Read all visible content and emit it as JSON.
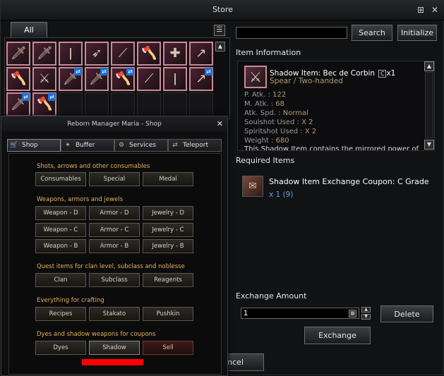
{
  "window": {
    "title": "Store"
  },
  "left": {
    "tab_all": "All",
    "grid": {
      "rows": [
        [
          "sword",
          "sword",
          "staff",
          "bow",
          "blade",
          "axe",
          "crossbow",
          "spear"
        ],
        [
          "axe",
          "swords",
          "sword",
          "sword",
          "axe",
          "blade",
          "staff",
          "spear"
        ],
        [
          "sword",
          "axe"
        ]
      ],
      "swap_marks": [
        [
          1,
          2
        ],
        [
          1,
          3
        ],
        [
          1,
          4
        ],
        [
          1,
          7
        ],
        [
          2,
          0
        ],
        [
          2,
          1
        ]
      ]
    }
  },
  "search": {
    "value": "",
    "search_label": "Search",
    "initialize_label": "Initialize"
  },
  "item_info": {
    "label": "Item Information",
    "name": "Shadow Item: Bec de Corbin",
    "grade": "C",
    "count": "x1",
    "type": "Spear / Two-handed",
    "stats": [
      {
        "label": "P. Atk. : ",
        "value": "122"
      },
      {
        "label": "M. Atk. : ",
        "value": "68"
      },
      {
        "label": "Atk. Spd. : ",
        "value": "Normal"
      },
      {
        "label": "Soulshot Used : ",
        "value": "X 2"
      },
      {
        "label": "Spiritshot Used : ",
        "value": "X 2"
      },
      {
        "label": "Weight : ",
        "value": "680"
      }
    ],
    "description": "This Shadow Item contains the mirrored power of"
  },
  "required": {
    "label": "Required Items",
    "item_name": "Shadow Item Exchange Coupon: C Grade",
    "qty_prefix": "x 1",
    "qty_have": "(9)"
  },
  "exchange": {
    "label": "Exchange Amount",
    "amount": "1",
    "delete_label": "Delete",
    "exchange_label": "Exchange",
    "cancel_fragment": "ncel"
  },
  "shop": {
    "title": "Reborn Manager Maria - Shop",
    "tabs": [
      "Shop",
      "Buffer",
      "Services",
      "Teleport"
    ],
    "sections": [
      {
        "title": "Shots, arrows and other consumables",
        "buttons": [
          "Consumables",
          "Special",
          "Medal"
        ]
      },
      {
        "title": "Weapons, armors and jewels",
        "buttons": [
          "Weapon - D",
          "Armor - D",
          "Jewelry - D",
          "Weapon - C",
          "Armor - C",
          "Jewelry - C",
          "Weapon - B",
          "Armor - B",
          "Jewelry - B"
        ]
      },
      {
        "title": "Quest items for clan level, subclass and noblesse",
        "buttons": [
          "Clan",
          "Subclass",
          "Reagents"
        ]
      },
      {
        "title": "Everything for crafting",
        "buttons": [
          "Recipes",
          "Stakato",
          "Pushkin"
        ]
      },
      {
        "title": "Dyes and shadow weapons for coupons",
        "buttons": [
          "Dyes",
          "Shadow",
          "Sell"
        ]
      }
    ]
  },
  "colors": {
    "grade_text": "#b39a6d",
    "section_title": "#e3b15a",
    "highlight_bar": "#ff0000",
    "qty_blue": "#6aa0d8"
  }
}
